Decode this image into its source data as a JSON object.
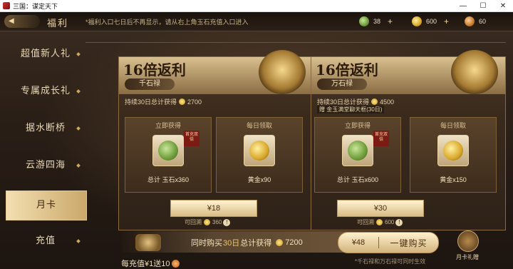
{
  "window": {
    "title": "三国：谋定天下",
    "controls": [
      "—",
      "☐",
      "✕"
    ]
  },
  "topbar": {
    "page_title": "福利",
    "notice": "*福利入口七日后不再显示，请从右上角玉石充值入口进入",
    "currencies": [
      {
        "icon": "jade-coin-icon",
        "value": "38",
        "plus": "+"
      },
      {
        "icon": "gold-coin-icon",
        "value": "600",
        "plus": "+"
      },
      {
        "icon": "bronze-coin-icon",
        "value": "60"
      }
    ]
  },
  "sidebar": {
    "items": [
      {
        "label": "超值新人礼",
        "active": false
      },
      {
        "label": "专属成长礼",
        "active": false
      },
      {
        "label": "据水断桥",
        "active": false
      },
      {
        "label": "云游四海",
        "active": false
      },
      {
        "label": "月卡",
        "active": true
      },
      {
        "label": "充值",
        "active": false
      }
    ]
  },
  "cards": [
    {
      "multiplier": "16倍返利",
      "tier": "千石禄",
      "total_text": "持续30日总计获得",
      "total_value": "2700",
      "extra": "",
      "instant": {
        "title": "立即获得",
        "label": "总计 玉石x360",
        "tag": "首充双倍"
      },
      "daily": {
        "title": "每日领取",
        "label": "黄金x90"
      },
      "price": "¥18",
      "refund_text": "可回溯",
      "refund_value": "360"
    },
    {
      "multiplier": "16倍返利",
      "tier": "万石禄",
      "total_text": "持续30日总计获得",
      "total_value": "4500",
      "extra": "赠 金玉满堂聊天框(30日)",
      "instant": {
        "title": "立即获得",
        "label": "总计 玉石x600",
        "tag": "首充双倍"
      },
      "daily": {
        "title": "每日领取",
        "label": "黄金x150"
      },
      "price": "¥30",
      "refund_text": "可回溯",
      "refund_value": "600"
    }
  ],
  "combo": {
    "text_before": "同时购买",
    "text_highlight": "30日",
    "text_after": "总计获得",
    "value": "7200",
    "price": "¥48",
    "button_label": "一键购买",
    "footnote": "*千石禄和万石禄可同时生效"
  },
  "recharge_promo": "每充值¥1送10",
  "gift": {
    "label": "月卡礼赠"
  },
  "colors": {
    "accent_gold": "#f2c460",
    "panel_brown": "#3a2a1c",
    "active_tab": "#f3dfb2"
  }
}
